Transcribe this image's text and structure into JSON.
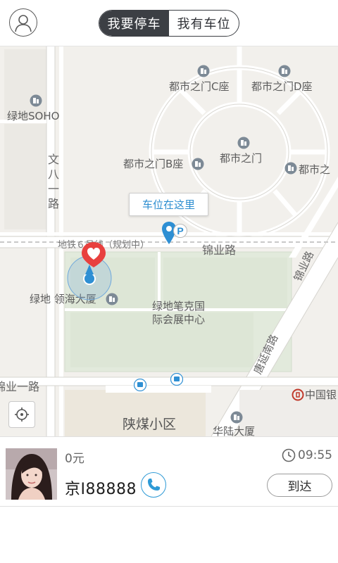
{
  "header": {
    "tabs": [
      {
        "label": "我要停车",
        "active": true
      },
      {
        "label": "我有车位",
        "active": false
      }
    ]
  },
  "map": {
    "callout_text": "车位在这里",
    "pois": [
      {
        "name": "都市之门C座"
      },
      {
        "name": "都市之门D座"
      },
      {
        "name": "绿地SOHO"
      },
      {
        "name": "都市之门B座"
      },
      {
        "name": "都市之门"
      },
      {
        "name": "都市之"
      },
      {
        "name": "绿地 领海大厦"
      },
      {
        "name": "绿地笔克国际会展中心"
      },
      {
        "name": "陕煤小区"
      },
      {
        "name": "华陆大厦"
      },
      {
        "name": "中国银"
      }
    ],
    "roads": [
      {
        "name": "文八一路"
      },
      {
        "name": "锦业路"
      },
      {
        "name": "地铁６号线（规划中）"
      },
      {
        "name": "锦业路"
      },
      {
        "name": "唐延南路"
      },
      {
        "name": "锦业一路"
      }
    ],
    "colors": {
      "pin_blue": "#2e8fd3",
      "heart_red": "#e8403e",
      "green_block": "#e2eadc"
    }
  },
  "card": {
    "price": "0元",
    "time": "09:55",
    "plate": "京I88888",
    "arrive_label": "到达"
  }
}
